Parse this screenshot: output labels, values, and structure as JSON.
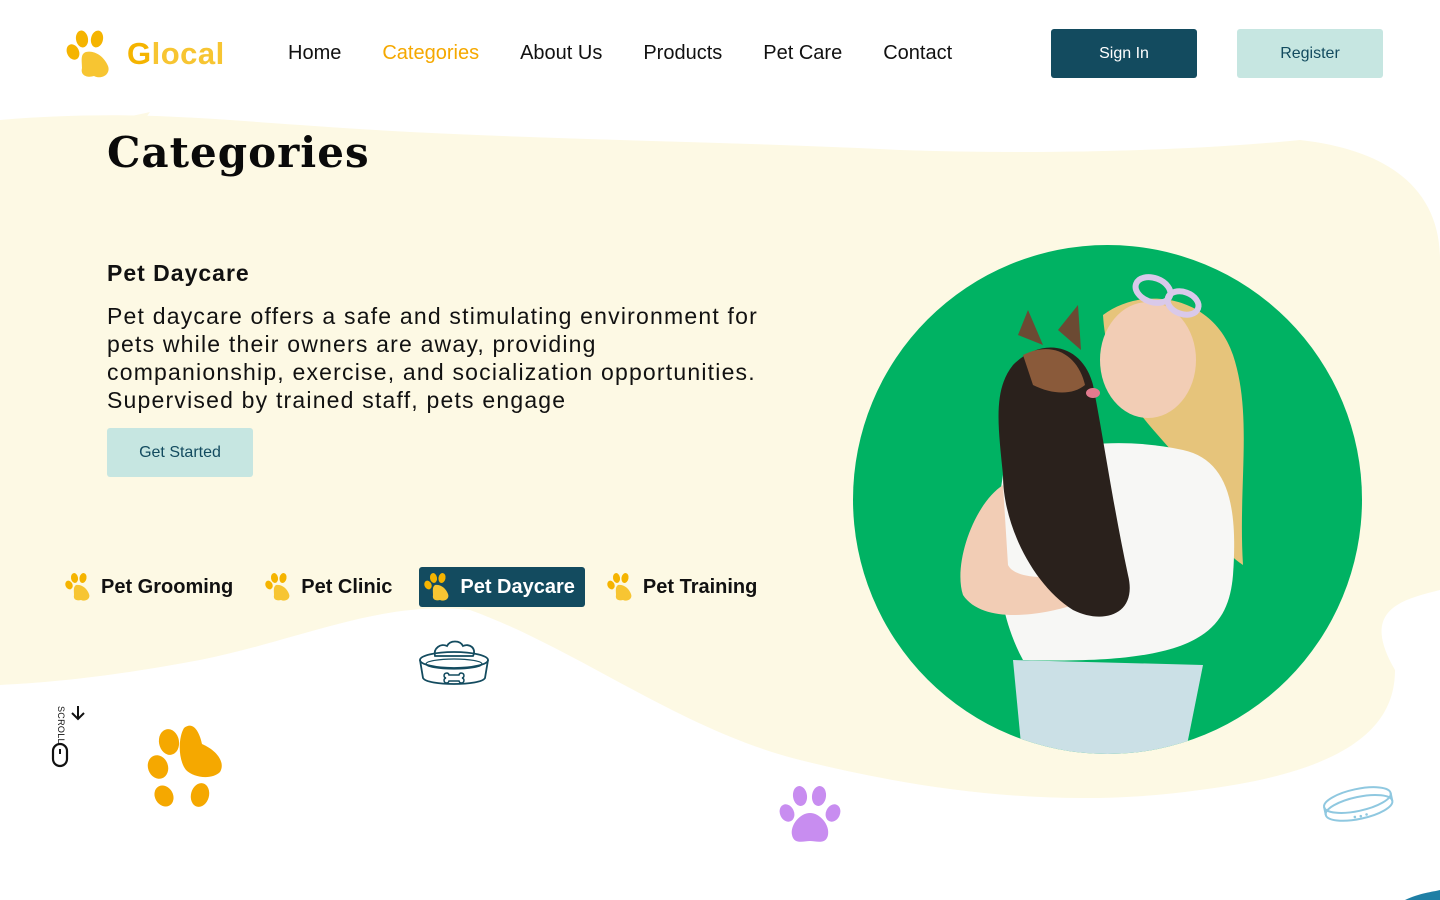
{
  "colors": {
    "brand_yellow": "#f5b400",
    "accent_orange": "#f5a800",
    "primary_dark": "#134b5f",
    "secondary_light": "#c6e6e1",
    "blob_cream": "#fdf9e4",
    "hero_green": "#00b263",
    "paw_purple": "#c88df0"
  },
  "header": {
    "logo": {
      "text_first": "G",
      "text_rest": "local",
      "icon": "paw-icon"
    },
    "nav": [
      {
        "label": "Home",
        "active": false
      },
      {
        "label": "Categories",
        "active": true
      },
      {
        "label": "About Us",
        "active": false
      },
      {
        "label": "Products",
        "active": false
      },
      {
        "label": "Pet Care",
        "active": false
      },
      {
        "label": "Contact",
        "active": false
      }
    ],
    "sign_in_label": "Sign In",
    "register_label": "Register"
  },
  "main": {
    "page_title": "Categories",
    "section_title": "Pet Daycare",
    "section_desc": "Pet daycare offers a safe and stimulating environment for pets while their owners are away, providing companionship, exercise, and socialization opportunities. Supervised by trained staff, pets engage",
    "cta_label": "Get Started",
    "tabs": [
      {
        "label": "Pet Grooming",
        "active": false,
        "icon": "paw-icon"
      },
      {
        "label": "Pet Clinic",
        "active": false,
        "icon": "paw-icon"
      },
      {
        "label": "Pet Daycare",
        "active": true,
        "icon": "paw-icon"
      },
      {
        "label": "Pet Training",
        "active": false,
        "icon": "paw-icon"
      }
    ],
    "scroll_label": "SCROLL",
    "hero_image": "woman-kissing-dog-photo"
  }
}
